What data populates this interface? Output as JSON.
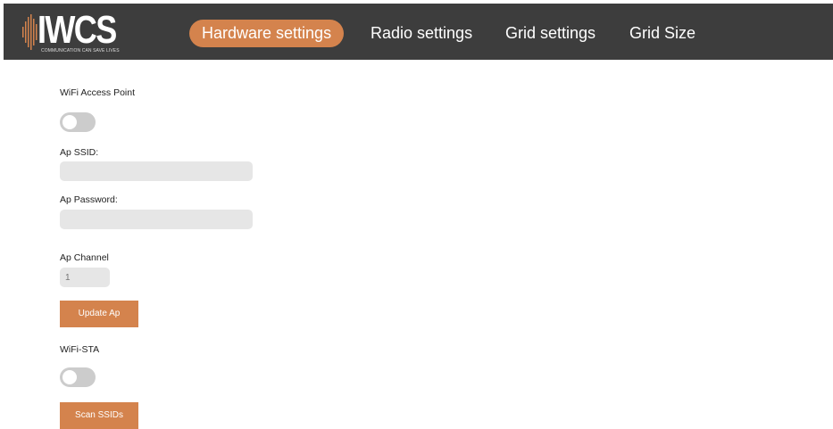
{
  "brand": {
    "name": "IWCS",
    "tagline": "COMMUNICATION CAN SAVE LIVES"
  },
  "nav": {
    "items": [
      {
        "label": "Hardware settings",
        "active": true
      },
      {
        "label": "Radio settings",
        "active": false
      },
      {
        "label": "Grid settings",
        "active": false
      },
      {
        "label": "Grid Size",
        "active": false
      }
    ]
  },
  "form": {
    "wifi_ap_label": "WiFi Access Point",
    "wifi_ap_enabled": false,
    "ap_ssid_label": "Ap SSID:",
    "ap_ssid_value": "",
    "ap_password_label": "Ap Password:",
    "ap_password_value": "",
    "ap_channel_label": "Ap Channel",
    "ap_channel_placeholder": "1",
    "update_ap_label": "Update Ap",
    "wifi_sta_label": "WiFi-STA",
    "wifi_sta_enabled": false,
    "scan_ssids_label": "Scan SSIDs"
  },
  "colors": {
    "navbar_bg": "#3d3d3d",
    "accent": "#d4834d",
    "input_bg": "#e6e6e6",
    "toggle_off": "#cccccc"
  }
}
